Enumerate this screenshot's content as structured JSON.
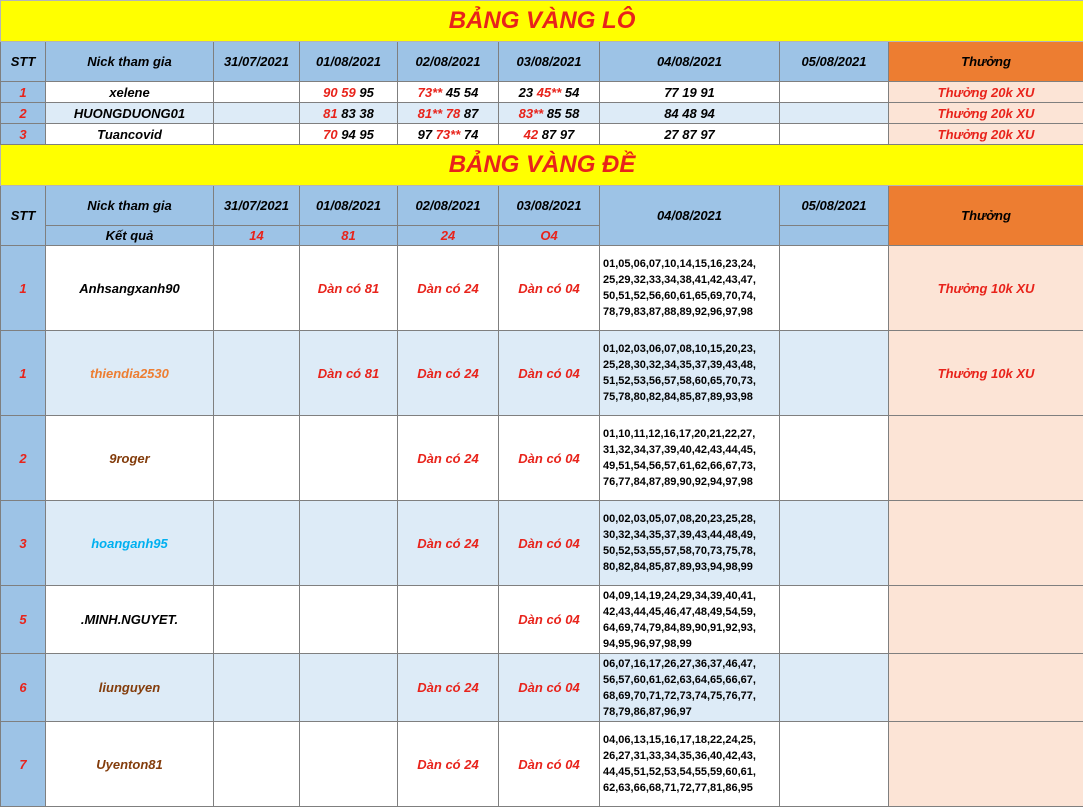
{
  "lo": {
    "title": "BẢNG VÀNG LÔ",
    "headers": {
      "stt": "STT",
      "nick": "Nick tham gia",
      "d1": "31/07/2021",
      "d2": "01/08/2021",
      "d3": "02/08/2021",
      "d4": "03/08/2021",
      "d5": "04/08/2021",
      "d6": "05/08/2021",
      "thuong": "Thưởng"
    },
    "rows": [
      {
        "stt": "1",
        "nick": "xelene",
        "d1": "",
        "d2r": "90 59",
        "d2b": "95",
        "d3r": "73**",
        "d3b": "45 54",
        "d4b1": "23",
        "d4r": "45**",
        "d4b2": "54",
        "d5": "77 19 91",
        "d6": "",
        "thuong": "Thưởng 20k XU"
      },
      {
        "stt": "2",
        "nick": "HUONGDUONG01",
        "d1": "",
        "d2r": "81",
        "d2b": "83 38",
        "d3r": "81** 78",
        "d3b": "87",
        "d4b1": "",
        "d4r": "83**",
        "d4b2": "85 58",
        "d5": "84 48 94",
        "d6": "",
        "thuong": "Thưởng 20k XU"
      },
      {
        "stt": "3",
        "nick": "Tuancovid",
        "d1": "",
        "d2r": "70",
        "d2b": "94 95",
        "d3r": "73**",
        "d3b0": "97",
        "d3b": "74",
        "d4b1": "",
        "d4r": "42",
        "d4b2": "87 97",
        "d5": "27 87 97",
        "d6": "",
        "thuong": "Thưởng 20k XU"
      }
    ]
  },
  "de": {
    "title": "BẢNG VÀNG ĐỀ",
    "headers": {
      "stt": "STT",
      "nick": "Nick tham gia",
      "d1": "31/07/2021",
      "d2": "01/08/2021",
      "d3": "02/08/2021",
      "d4": "03/08/2021",
      "d5": "04/08/2021",
      "d6": "05/08/2021",
      "thuong": "Thưởng"
    },
    "result": {
      "label": "Kết quả",
      "d1": "14",
      "d2": "81",
      "d3": "24",
      "d4": "O4"
    },
    "rows": [
      {
        "stt": "1",
        "nick": "Anhsangxanh90",
        "d2": "Dàn có 81",
        "d3": "Dàn có 24",
        "d4": "Dàn có 04",
        "nums": "01,05,06,07,10,14,15,16,23,24,\n25,29,32,33,34,38,41,42,43,47,\n50,51,52,56,60,61,65,69,70,74,\n78,79,83,87,88,89,92,96,97,98",
        "thuong": "Thưởng 10k XU"
      },
      {
        "stt": "1",
        "nick": "thiendia2530",
        "d2": "Dàn có 81",
        "d3": "Dàn có 24",
        "d4": "Dàn có 04",
        "nums": "01,02,03,06,07,08,10,15,20,23,\n25,28,30,32,34,35,37,39,43,48,\n51,52,53,56,57,58,60,65,70,73,\n75,78,80,82,84,85,87,89,93,98",
        "thuong": "Thưởng 10k XU"
      },
      {
        "stt": "2",
        "nick": "9roger",
        "d2": "",
        "d3": "Dàn có 24",
        "d4": "Dàn có 04",
        "nums": "01,10,11,12,16,17,20,21,22,27,\n31,32,34,37,39,40,42,43,44,45,\n49,51,54,56,57,61,62,66,67,73,\n76,77,84,87,89,90,92,94,97,98",
        "thuong": ""
      },
      {
        "stt": "3",
        "nick": "hoanganh95",
        "d2": "",
        "d3": "Dàn có 24",
        "d4": "Dàn có 04",
        "nums": "00,02,03,05,07,08,20,23,25,28,\n30,32,34,35,37,39,43,44,48,49,\n50,52,53,55,57,58,70,73,75,78,\n80,82,84,85,87,89,93,94,98,99",
        "thuong": ""
      },
      {
        "stt": "5",
        "nick": ".MINH.NGUYET.",
        "d2": "",
        "d3": "",
        "d4": "Dàn có 04",
        "nums": "04,09,14,19,24,29,34,39,40,41,\n42,43,44,45,46,47,48,49,54,59,\n64,69,74,79,84,89,90,91,92,93,\n94,95,96,97,98,99",
        "thuong": ""
      },
      {
        "stt": "6",
        "nick": "liunguyen",
        "d2": "",
        "d3": "Dàn có 24",
        "d4": "Dàn có 04",
        "nums": "06,07,16,17,26,27,36,37,46,47,\n56,57,60,61,62,63,64,65,66,67,\n68,69,70,71,72,73,74,75,76,77,\n78,79,86,87,96,97",
        "thuong": ""
      },
      {
        "stt": "7",
        "nick": "Uyenton81",
        "d2": "",
        "d3": "Dàn có 24",
        "d4": "Dàn có 04",
        "nums": "04,06,13,15,16,17,18,22,24,25,\n26,27,31,33,34,35,36,40,42,43,\n44,45,51,52,53,54,55,59,60,61,\n62,63,66,68,71,72,77,81,86,95",
        "thuong": ""
      }
    ]
  }
}
